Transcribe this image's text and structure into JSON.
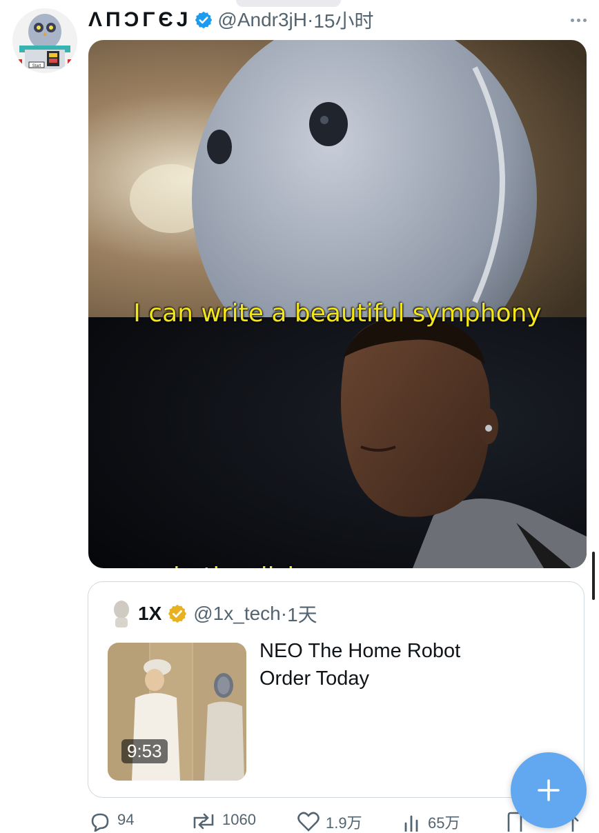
{
  "post": {
    "author_name": "ΛΠϽΓЄJ",
    "handle": "@Andr3jH",
    "separator": "·",
    "time": "15小时",
    "caption_top": "I can write a beautiful symphony",
    "caption_bottom": "do the dishes"
  },
  "avatar_badge": "Start",
  "quote": {
    "name": "1X",
    "handle": "@1x_tech",
    "separator": "·",
    "time": "1天",
    "title_line1": "NEO The Home Robot",
    "title_line2": "Order Today",
    "video_duration": "9:53"
  },
  "actions": {
    "replies": "94",
    "reposts": "1060",
    "likes": "1.9万",
    "views": "65万"
  },
  "colors": {
    "verified_blue": "#1d9bf0",
    "gold_badge": "#e8b120",
    "caption_yellow": "#f4e61c",
    "fab_blue": "#62a8f0"
  },
  "icons": [
    "verified-icon",
    "more-icon",
    "gold-verified-icon",
    "reply-icon",
    "repost-icon",
    "like-icon",
    "views-icon",
    "bookmark-icon",
    "share-icon",
    "compose-plus-icon"
  ]
}
